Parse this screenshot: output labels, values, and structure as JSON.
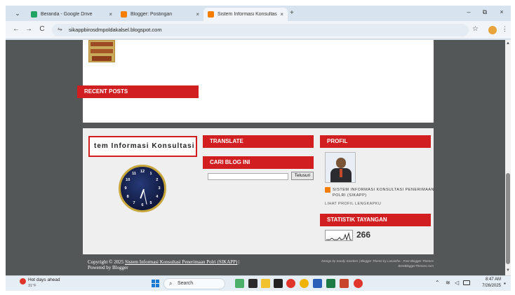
{
  "browser": {
    "tabs": [
      {
        "title": "Beranda - Google Drive",
        "favicon_color": "#1fa463",
        "active": false
      },
      {
        "title": "Blogger: Postingan",
        "favicon_color": "#f57d00",
        "active": false
      },
      {
        "title": "Sistem Informasi Konsultasi Pen",
        "favicon_color": "#f57d00",
        "active": true
      }
    ],
    "tab_close_glyph": "×",
    "new_tab_glyph": "+",
    "window_controls": {
      "minimize": "–",
      "restore": "⧉",
      "close": "×"
    },
    "nav": {
      "back": "←",
      "forward": "→",
      "reload": "C"
    },
    "url": "sikappbirosdmpoldakalsel.blogspot.com",
    "icons": [
      "tab-search-icon",
      "back-arrow-icon",
      "forward-arrow-icon",
      "reload-icon",
      "site-settings-icon",
      "bookmark-star-icon",
      "profile-icon",
      "more-menu-icon"
    ]
  },
  "page": {
    "recent_posts_heading": "RECENT POSTS",
    "marquee_text": "tem Informasi Konsultasi",
    "translate_heading": "TRANSLATE",
    "cari_blog_heading": "CARI BLOG INI",
    "search_button": "Telusuri",
    "profil_heading": "PROFIL",
    "profile_name": "SISTEM INFORMASI KONSULTASI PENERIMAAN POLRI (SIKAPP)",
    "profile_link": "LIHAT PROFIL LENGKAPKU",
    "statistik_heading": "STATISTIK TAYANGAN",
    "view_count": "266",
    "clock_numbers": [
      "12",
      "1",
      "2",
      "3",
      "4",
      "5",
      "6",
      "7",
      "8",
      "9",
      "10",
      "11"
    ],
    "copyright_prefix": "Copyright © 2025",
    "copyright_link": "Sistem Informasi Konsultasi Penerimaan Polri (SIKAPP)",
    "copyright_suffix": "|",
    "powered_by": "Powered by Blogger",
    "credits_line1": "Design by Sandy Sanders | Blogger Theme by Lasantha - Free Blogger Themes",
    "credits_line2": "BestBloggerThemes.com",
    "accent_color": "#d11f21"
  },
  "taskbar": {
    "weather_title": "Hot days ahead",
    "weather_temp": "31°F",
    "search_label": "Search",
    "time": "8:47 AM",
    "date": "7/26/2025",
    "pinned_icons": [
      "widgets-icon",
      "task-view-icon",
      "file-explorer-icon",
      "opera-icon",
      "chrome-icon",
      "word-icon",
      "excel-icon",
      "powerpoint-icon",
      "chrome-profile-icon"
    ]
  }
}
